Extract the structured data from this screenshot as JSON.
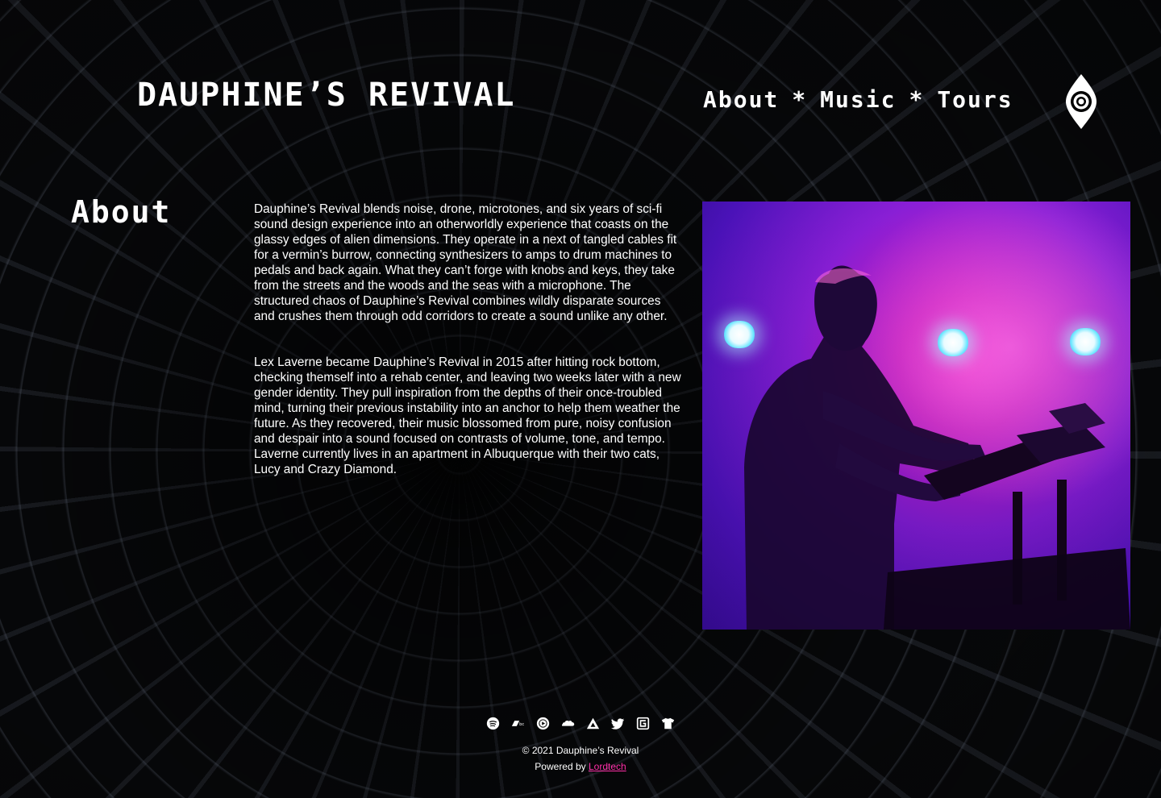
{
  "header": {
    "site_title": "DAUPHINE’S REVIVAL",
    "nav": [
      {
        "label": "About"
      },
      {
        "label": "Music"
      },
      {
        "label": "Tours"
      }
    ],
    "nav_separator": "*",
    "logo_icon": "eye-logo-icon"
  },
  "main": {
    "heading": "About",
    "paragraphs": [
      "Dauphine’s Revival blends noise, drone, microtones, and six years of sci-fi sound design experience into an otherworldly experience that coasts on the glassy edges of alien dimensions. They operate in a next of tangled cables fit for a vermin’s burrow, connecting synthesizers to amps to drum machines to pedals and back again. What they can’t forge with knobs and keys, they take from the streets and the woods and the seas with a microphone. The structured chaos of Dauphine’s Revival combines wildly disparate sources and crushes them through odd corridors to create a sound unlike any other.",
      "Lex Laverne became Dauphine’s Revival in 2015 after hitting rock bottom, checking themself into a rehab center, and leaving two weeks later with a new gender identity. They pull inspiration from the depths of their once-troubled mind, turning their previous instability into an anchor to help them weather the future. As they recovered, their music blossomed from pure, noisy confusion and despair into a sound focused on contrasts of volume, tone, and tempo. Laverne currently lives in an apartment in Albuquerque with their two cats, Lucy and Crazy Diamond."
    ],
    "photo_icon": "performer-photo"
  },
  "footer": {
    "social_icons": [
      "spotify-icon",
      "bandcamp-icon",
      "youtube-music-icon",
      "soundcloud-icon",
      "audius-icon",
      "twitter-icon",
      "gab-icon",
      "merch-shirt-icon"
    ],
    "copyright": "© 2021 Dauphine’s Revival",
    "powered_prefix": "Powered by ",
    "powered_link": "Lordtech"
  },
  "colors": {
    "background": "#000000",
    "text": "#ffffff",
    "link_accent": "#ff2ea8"
  }
}
